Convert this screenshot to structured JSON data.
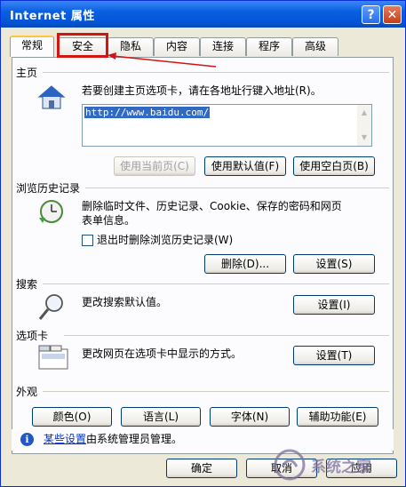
{
  "window": {
    "title": "Internet 属性"
  },
  "titlebar": {
    "help_glyph": "?",
    "close_glyph": "✕"
  },
  "tabs": [
    {
      "label": "常规",
      "active": true
    },
    {
      "label": "安全",
      "highlighted": true
    },
    {
      "label": "隐私"
    },
    {
      "label": "内容"
    },
    {
      "label": "连接"
    },
    {
      "label": "程序"
    },
    {
      "label": "高级"
    }
  ],
  "homepage": {
    "title": "主页",
    "desc": "若要创建主页选项卡，请在各地址行键入地址(R)。",
    "url": "http://www.baidu.com/",
    "buttons": {
      "use_current": "使用当前页(C)",
      "use_default": "使用默认值(F)",
      "use_blank": "使用空白页(B)"
    }
  },
  "history": {
    "title": "浏览历史记录",
    "desc_line1": "删除临时文件、历史记录、Cookie、保存的密码和网页",
    "desc_line2": "表单信息。",
    "checkbox_label": "退出时删除浏览历史记录(W)",
    "checkbox_checked": false,
    "delete_label": "删除(D)...",
    "settings_label": "设置(S)"
  },
  "search": {
    "title": "搜索",
    "desc": "更改搜索默认值。",
    "settings_label": "设置(I)"
  },
  "tabsgroup": {
    "title": "选项卡",
    "desc": "更改网页在选项卡中显示的方式。",
    "settings_label": "设置(T)"
  },
  "appearance": {
    "title": "外观",
    "buttons": [
      "颜色(O)",
      "语言(L)",
      "字体(N)",
      "辅助功能(E)"
    ]
  },
  "info": {
    "link": "某些设置",
    "text": "由系统管理员管理。"
  },
  "footer": {
    "ok": "确定",
    "cancel": "取消",
    "apply": "应用"
  },
  "watermark": {
    "text": "系统之家"
  },
  "colors": {
    "accent_highlight": "#d41414",
    "titlebar": "#0a5fe0"
  }
}
